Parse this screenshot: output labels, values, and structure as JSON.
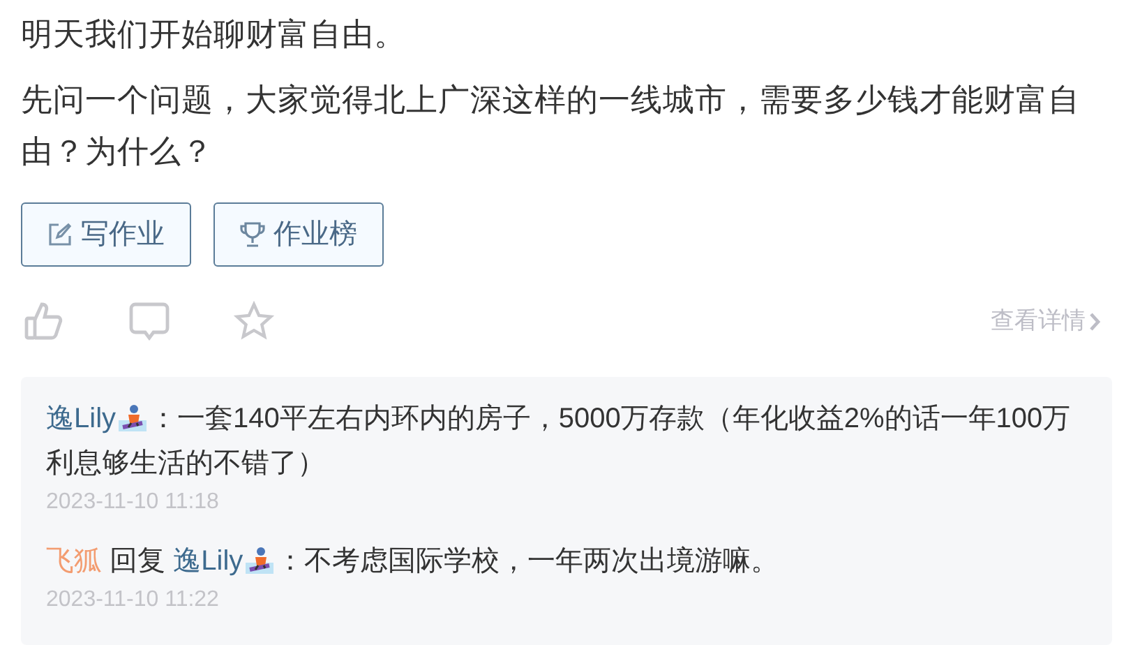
{
  "paragraphs": [
    "明天我们开始聊财富自由。",
    "先问一个问题，大家觉得北上广深这样的一线城市，需要多少钱才能财富自由？为什么？"
  ],
  "buttons": [
    {
      "kind": "edit",
      "label": "写作业"
    },
    {
      "kind": "trophy",
      "label": "作业榜"
    }
  ],
  "actions": [
    {
      "kind": "like"
    },
    {
      "kind": "comment"
    },
    {
      "kind": "star"
    }
  ],
  "details_link": "查看详情",
  "comments": [
    {
      "author": {
        "name": "逸Lily",
        "color": "#3d6a8e",
        "emoji": true
      },
      "text": "：一套140平左右内环内的房子，5000万存款（年化收益2%的话一年100万利息够生活的不错了）",
      "time": "2023-11-10 11:18"
    },
    {
      "author": {
        "name": "飞狐",
        "color": "#f39c70",
        "emoji": false
      },
      "reply_word": "回复",
      "reply_to": {
        "name": "逸Lily",
        "color": "#3d6a8e",
        "emoji": true
      },
      "text": "：不考虑国际学校，一年两次出境游嘛。",
      "time": "2023-11-10 11:22"
    }
  ]
}
